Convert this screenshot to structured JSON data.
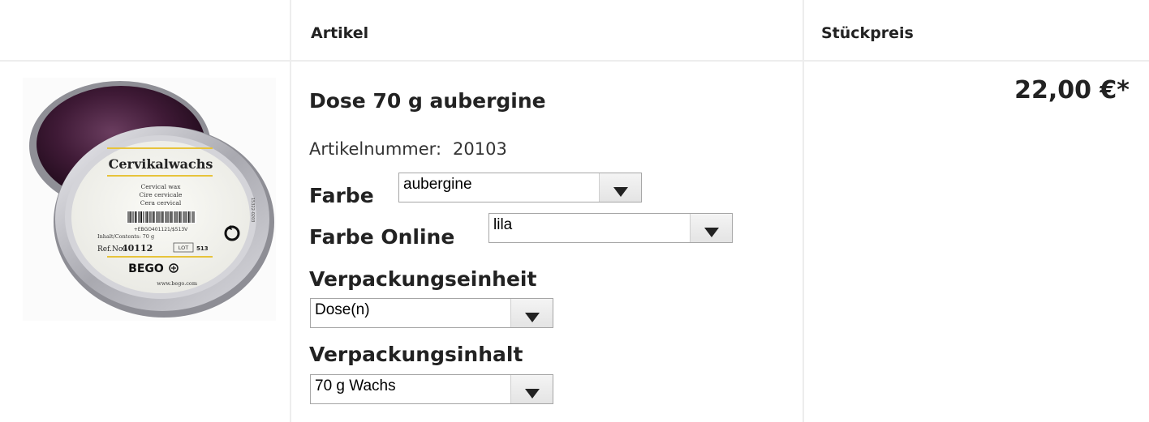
{
  "table": {
    "headers": {
      "artikel": "Artikel",
      "stueckpreis": "Stückpreis"
    }
  },
  "product": {
    "title": "Dose 70 g aubergine",
    "article_number_label": "Artikelnummer:",
    "article_number": "20103",
    "price": "22,00 €*",
    "image": {
      "brand": "Cervikalwachs",
      "lines": [
        "Cervical wax",
        "Cire cervicale",
        "Cera cervical"
      ],
      "barcode_text": "+EBGO401121/$513V",
      "contents": "Inhalt/Contents: 70 g",
      "ref_label": "Ref.No.",
      "ref_number": "40112",
      "lot_label": "LOT",
      "lot_number": "513",
      "maker": "BEGO",
      "url": "www.bego.com",
      "side_code": "15322-0203",
      "colors": {
        "wax": "#3f1a36",
        "tin": "#c9c9cf",
        "label": "#f3f3ee",
        "stripe": "#e7c33b"
      }
    },
    "options": {
      "farbe": {
        "label": "Farbe",
        "value": "aubergine"
      },
      "farbe_online": {
        "label": "Farbe Online",
        "value": "lila"
      },
      "verpackungseinheit": {
        "label": "Verpackungseinheit",
        "value": "Dose(n)"
      },
      "verpackungsinhalt": {
        "label": "Verpackungsinhalt",
        "value": "70 g Wachs"
      }
    }
  },
  "icons": {
    "select_arrow": "chevron-down-icon"
  }
}
